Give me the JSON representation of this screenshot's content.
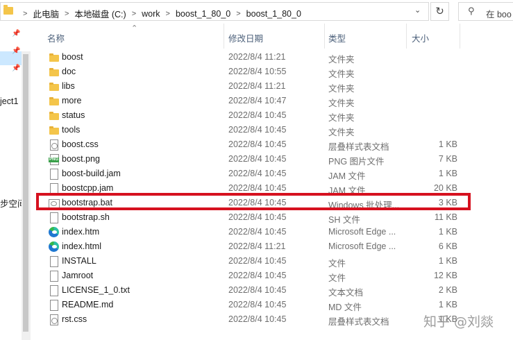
{
  "address": {
    "breadcrumbs": [
      "此电脑",
      "本地磁盘 (C:)",
      "work",
      "boost_1_80_0",
      "boost_1_80_0"
    ],
    "search_placeholder": "在 boo"
  },
  "nav": {
    "items": [
      {
        "label": "ject1"
      },
      {
        "label": "步空间"
      }
    ]
  },
  "columns": {
    "name": "名称",
    "date": "修改日期",
    "type": "类型",
    "size": "大小"
  },
  "files": [
    {
      "icon": "folder-icon",
      "name": "boost",
      "date": "2022/8/4 11:21",
      "type": "文件夹",
      "size": ""
    },
    {
      "icon": "folder-icon",
      "name": "doc",
      "date": "2022/8/4 10:55",
      "type": "文件夹",
      "size": ""
    },
    {
      "icon": "folder-icon",
      "name": "libs",
      "date": "2022/8/4 11:21",
      "type": "文件夹",
      "size": ""
    },
    {
      "icon": "folder-icon",
      "name": "more",
      "date": "2022/8/4 10:47",
      "type": "文件夹",
      "size": ""
    },
    {
      "icon": "folder-icon",
      "name": "status",
      "date": "2022/8/4 10:45",
      "type": "文件夹",
      "size": ""
    },
    {
      "icon": "folder-icon",
      "name": "tools",
      "date": "2022/8/4 10:45",
      "type": "文件夹",
      "size": ""
    },
    {
      "icon": "css-file-icon",
      "name": "boost.css",
      "date": "2022/8/4 10:45",
      "type": "层叠样式表文档",
      "size": "1 KB"
    },
    {
      "icon": "png-file-icon",
      "name": "boost.png",
      "date": "2022/8/4 10:45",
      "type": "PNG 图片文件",
      "size": "7 KB"
    },
    {
      "icon": "file-icon",
      "name": "boost-build.jam",
      "date": "2022/8/4 10:45",
      "type": "JAM 文件",
      "size": "1 KB"
    },
    {
      "icon": "file-icon",
      "name": "boostcpp.jam",
      "date": "2022/8/4 10:45",
      "type": "JAM 文件",
      "size": "20 KB"
    },
    {
      "icon": "bat-file-icon",
      "name": "bootstrap.bat",
      "date": "2022/8/4 10:45",
      "type": "Windows 批处理...",
      "size": "3 KB"
    },
    {
      "icon": "file-icon",
      "name": "bootstrap.sh",
      "date": "2022/8/4 10:45",
      "type": "SH 文件",
      "size": "11 KB"
    },
    {
      "icon": "edge-icon",
      "name": "index.htm",
      "date": "2022/8/4 10:45",
      "type": "Microsoft Edge ...",
      "size": "1 KB"
    },
    {
      "icon": "edge-icon",
      "name": "index.html",
      "date": "2022/8/4 11:21",
      "type": "Microsoft Edge ...",
      "size": "6 KB"
    },
    {
      "icon": "file-icon",
      "name": "INSTALL",
      "date": "2022/8/4 10:45",
      "type": "文件",
      "size": "1 KB"
    },
    {
      "icon": "file-icon",
      "name": "Jamroot",
      "date": "2022/8/4 10:45",
      "type": "文件",
      "size": "12 KB"
    },
    {
      "icon": "file-icon",
      "name": "LICENSE_1_0.txt",
      "date": "2022/8/4 10:45",
      "type": "文本文档",
      "size": "2 KB"
    },
    {
      "icon": "file-icon",
      "name": "README.md",
      "date": "2022/8/4 10:45",
      "type": "MD 文件",
      "size": "1 KB"
    },
    {
      "icon": "css-file-icon",
      "name": "rst.css",
      "date": "2022/8/4 10:45",
      "type": "层叠样式表文档",
      "size": "1 KB"
    }
  ],
  "highlighted_file": "bootstrap.bat",
  "highlight_color": "#d6111f",
  "watermark": "知乎 @刘燚"
}
